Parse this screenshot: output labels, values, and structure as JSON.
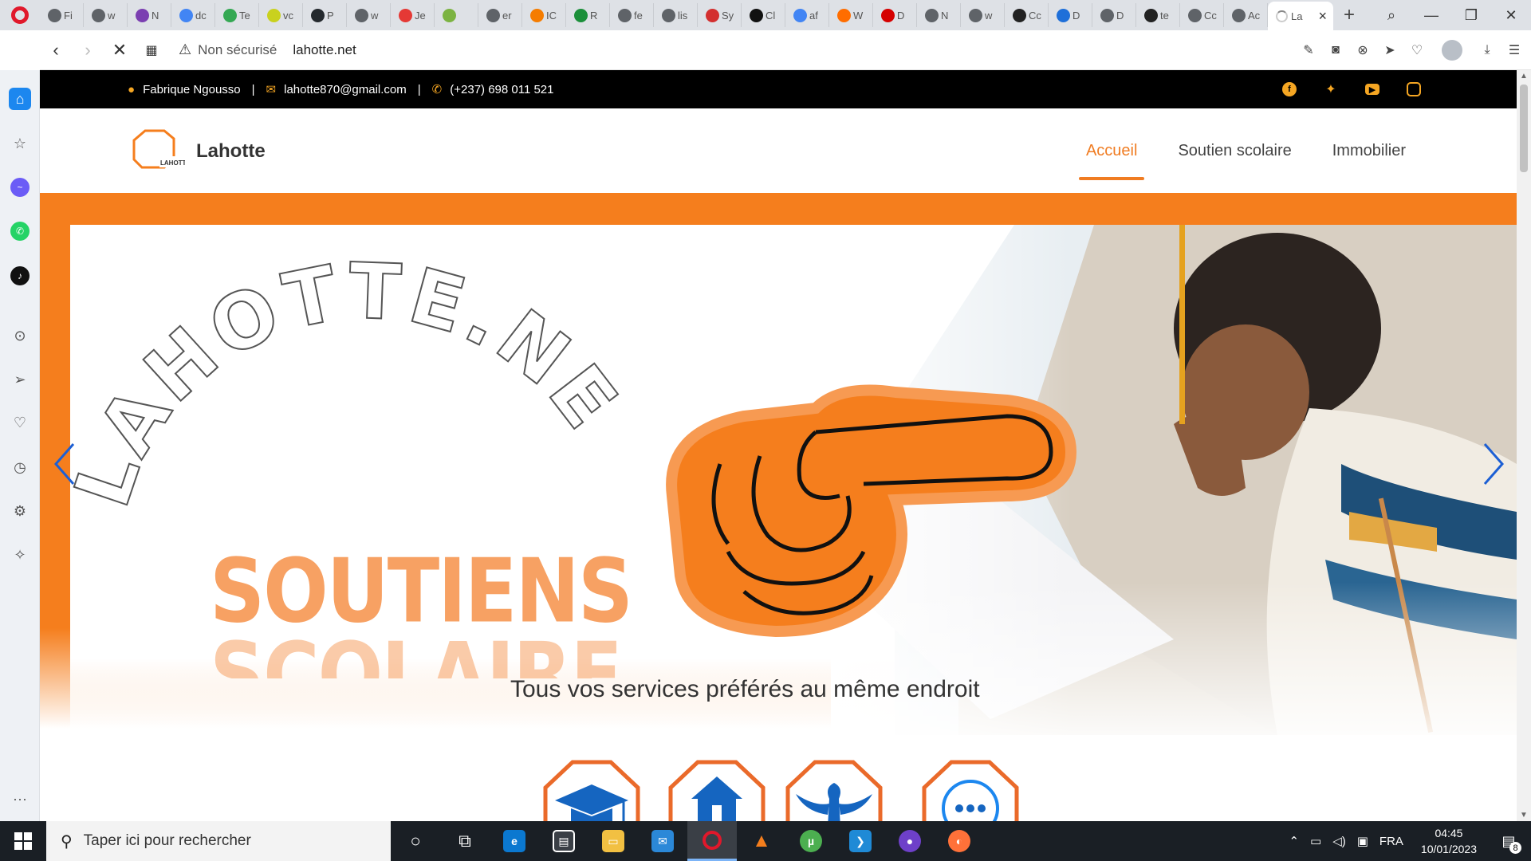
{
  "browser": {
    "tabs": [
      {
        "label": "Fi",
        "color": "#5f6368"
      },
      {
        "label": "w",
        "color": "#5f6368"
      },
      {
        "label": "N",
        "color": "#7b3fb1"
      },
      {
        "label": "dc",
        "color": "#4285f4"
      },
      {
        "label": "Te",
        "color": "#34a853"
      },
      {
        "label": "vc",
        "color": "#c9d11e"
      },
      {
        "label": "P",
        "color": "#24292e"
      },
      {
        "label": "w",
        "color": "#5f6368"
      },
      {
        "label": "Je",
        "color": "#e53935"
      },
      {
        "label": "",
        "color": "#7cb342"
      },
      {
        "label": "er",
        "color": "#5f6368"
      },
      {
        "label": "IC",
        "color": "#f57c00"
      },
      {
        "label": "R",
        "color": "#1b8f3a"
      },
      {
        "label": "fe",
        "color": "#5f6368"
      },
      {
        "label": "lis",
        "color": "#5f6368"
      },
      {
        "label": "Sy",
        "color": "#d32f2f"
      },
      {
        "label": "Cl",
        "color": "#111111"
      },
      {
        "label": "af",
        "color": "#4285f4"
      },
      {
        "label": "W",
        "color": "#ff6d00"
      },
      {
        "label": "D",
        "color": "#d50000"
      },
      {
        "label": "N",
        "color": "#5f6368"
      },
      {
        "label": "w",
        "color": "#5f6368"
      },
      {
        "label": "Cc",
        "color": "#222222"
      },
      {
        "label": "D",
        "color": "#1e6fd9"
      },
      {
        "label": "D",
        "color": "#5f6368"
      },
      {
        "label": "te",
        "color": "#222222"
      },
      {
        "label": "Cc",
        "color": "#5f6368"
      },
      {
        "label": "Ac",
        "color": "#5f6368"
      }
    ],
    "active_tab_label": "La",
    "security_label": "Non sécurisé",
    "url": "lahotte.net"
  },
  "site": {
    "topbar": {
      "location": "Fabrique Ngousso",
      "email": "lahotte870@gmail.com",
      "phone": "(+237) 698 011 521",
      "separator": "|"
    },
    "logo": {
      "name": "Lahotte",
      "mark_text": "LAHOTTE"
    },
    "menu": [
      {
        "label": "Accueil",
        "active": true
      },
      {
        "label": "Soutien scolaire",
        "active": false
      },
      {
        "label": "Immobilier",
        "active": false
      }
    ],
    "hero": {
      "arc_text": "LAHOTTE.NET",
      "headline_1": "SOUTIENS",
      "headline_2": "SCOLAIRE",
      "tagline": "Tous vos services préférés au même endroit"
    },
    "services": [
      {
        "icon": "graduation-cap-icon"
      },
      {
        "icon": "house-hand-icon"
      },
      {
        "icon": "phoenix-icon"
      },
      {
        "icon": "more-icon"
      }
    ],
    "accent_color": "#f57e1d"
  },
  "taskbar": {
    "search_placeholder": "Taper ici pour rechercher",
    "language": "FRA",
    "time": "04:45",
    "date": "10/01/2023",
    "notification_count": "8"
  }
}
